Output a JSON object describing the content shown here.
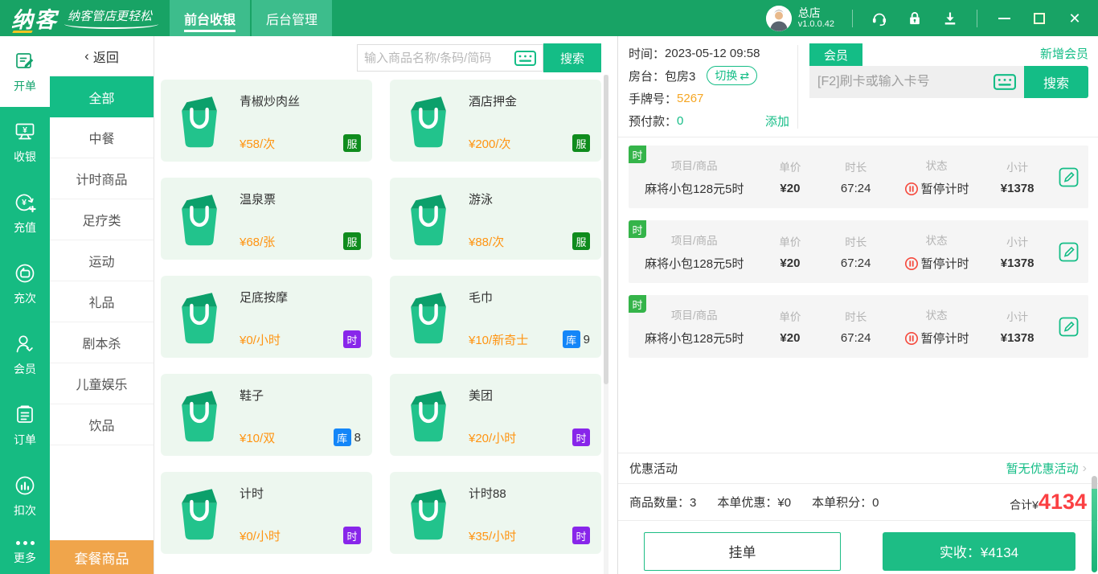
{
  "topbar": {
    "logo": "纳客",
    "tagline": "纳客管店更轻松",
    "tabs": [
      {
        "label": "前台收银"
      },
      {
        "label": "后台管理"
      }
    ],
    "store": "总店",
    "version": "v1.0.0.42"
  },
  "sidebar": {
    "items": [
      {
        "label": "开单",
        "active": true
      },
      {
        "label": "收银"
      },
      {
        "label": "充值"
      },
      {
        "label": "充次"
      },
      {
        "label": "会员"
      },
      {
        "label": "订单"
      },
      {
        "label": "扣次"
      }
    ],
    "more_label": "更多"
  },
  "categories": {
    "back_label": "返回",
    "items": [
      {
        "label": "全部",
        "active": true
      },
      {
        "label": "中餐"
      },
      {
        "label": "计时商品"
      },
      {
        "label": "足疗类"
      },
      {
        "label": "运动"
      },
      {
        "label": "礼品"
      },
      {
        "label": "剧本杀"
      },
      {
        "label": "儿童娱乐"
      },
      {
        "label": "饮品"
      }
    ],
    "package_button": "套餐商品"
  },
  "products": {
    "search_placeholder": "输入商品名称/条码/简码",
    "search_button": "搜索",
    "items": [
      {
        "name": "青椒炒肉丝",
        "price": "¥58/次",
        "badge": "服"
      },
      {
        "name": "酒店押金",
        "price": "¥200/次",
        "badge": "服"
      },
      {
        "name": "温泉票",
        "price": "¥68/张",
        "badge": "服"
      },
      {
        "name": "游泳",
        "price": "¥88/次",
        "badge": "服"
      },
      {
        "name": "足底按摩",
        "price": "¥0/小时",
        "badge": "时"
      },
      {
        "name": "毛巾",
        "price": "¥10/新奇士",
        "badge": "库",
        "stock": "9"
      },
      {
        "name": "鞋子",
        "price": "¥10/双",
        "badge": "库",
        "stock": "8"
      },
      {
        "name": "美团",
        "price": "¥20/小时",
        "badge": "时"
      },
      {
        "name": "计时",
        "price": "¥0/小时",
        "badge": "时"
      },
      {
        "name": "计时88",
        "price": "¥35/小时",
        "badge": "时"
      }
    ]
  },
  "order_panel": {
    "time_label": "时间：",
    "time": "2023-05-12 09:58",
    "room_label": "房台：",
    "room": "包房3",
    "switch_button": "切换",
    "card_label": "手牌号：",
    "card_no": "5267",
    "prepay_label": "预付款：",
    "prepay": "0",
    "add_link": "添加",
    "member_tab": "会员",
    "new_member_link": "新增会员",
    "member_placeholder": "[F2]刷卡或输入卡号",
    "member_search_button": "搜索",
    "columns": {
      "item": "项目/商品",
      "price": "单价",
      "duration": "时长",
      "status": "状态",
      "subtotal": "小计"
    },
    "rows": [
      {
        "badge": "时",
        "name": "麻将小包128元5时",
        "price": "¥20",
        "duration": "67:24",
        "status": "暂停计时",
        "subtotal": "¥1378"
      },
      {
        "badge": "时",
        "name": "麻将小包128元5时",
        "price": "¥20",
        "duration": "67:24",
        "status": "暂停计时",
        "subtotal": "¥1378"
      },
      {
        "badge": "时",
        "name": "麻将小包128元5时",
        "price": "¥20",
        "duration": "67:24",
        "status": "暂停计时",
        "subtotal": "¥1378"
      }
    ],
    "promo_label": "优惠活动",
    "promo_link": "暂无优惠活动",
    "qty_label": "商品数量：",
    "qty": "3",
    "discount_label": "本单优惠：",
    "discount": "¥0",
    "points_label": "本单积分：",
    "points": "0",
    "total_label": "合计¥",
    "total": "4134",
    "hold_button": "挂单",
    "pay_button": "实收：¥4134"
  },
  "icons": {
    "back_chevron": "‹",
    "promo_chevron": "›",
    "switch_arrows": "⇄",
    "close_glyph": "✕"
  },
  "colors": {
    "topbar_green": "#18a365",
    "sidebar_green": "#16bb82",
    "accent_green": "#14bd86",
    "package_orange": "#f0a54b",
    "price_orange": "#ff9412",
    "total_red": "#fb4043",
    "badge_service_green": "#0f8c1d",
    "badge_time_purple": "#8826ea",
    "badge_stock_blue": "#1486f8",
    "row_badge_green": "#35b44a",
    "pause_red": "#f5493d"
  }
}
